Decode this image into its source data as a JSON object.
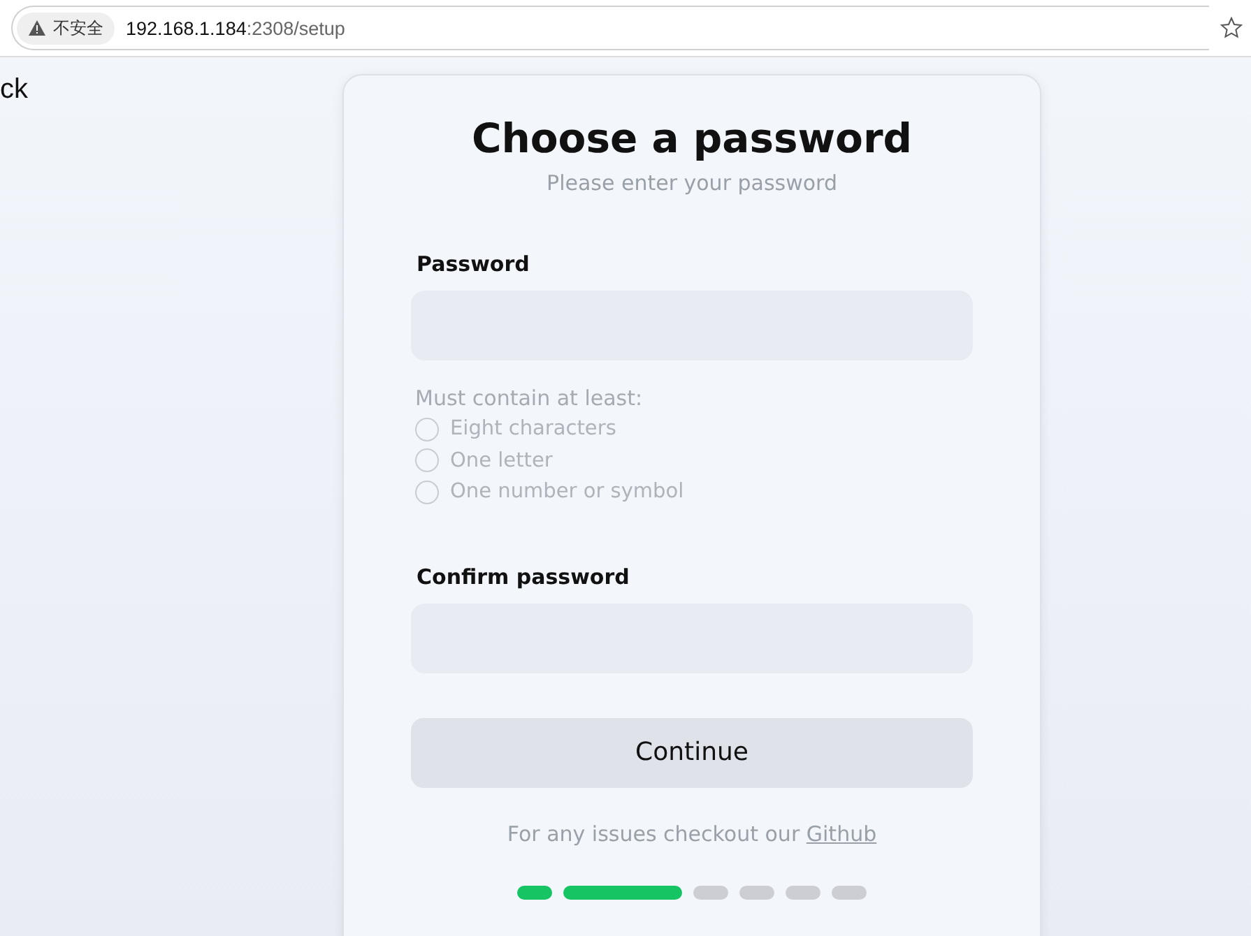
{
  "browser": {
    "security_label": "不安全",
    "url_host": "192.168.1.184",
    "url_rest": ":2308/setup"
  },
  "back_text": "ck",
  "card": {
    "title": "Choose a password",
    "subtitle": "Please enter your password",
    "password": {
      "label": "Password"
    },
    "rules_title": "Must contain at least:",
    "rules": [
      {
        "label": "Eight characters",
        "checked": false
      },
      {
        "label": "One letter",
        "checked": false
      },
      {
        "label": "One number or symbol",
        "checked": false
      }
    ],
    "confirm": {
      "label": "Confirm password"
    },
    "button": {
      "label": "Continue",
      "disabled": true
    },
    "footer": "For any issues checkout our",
    "footer_link": "Github",
    "steps": [
      {
        "kind": "done"
      },
      {
        "kind": "current"
      },
      {
        "kind": "todo"
      },
      {
        "kind": "todo"
      },
      {
        "kind": "todo"
      },
      {
        "kind": "todo"
      }
    ]
  }
}
